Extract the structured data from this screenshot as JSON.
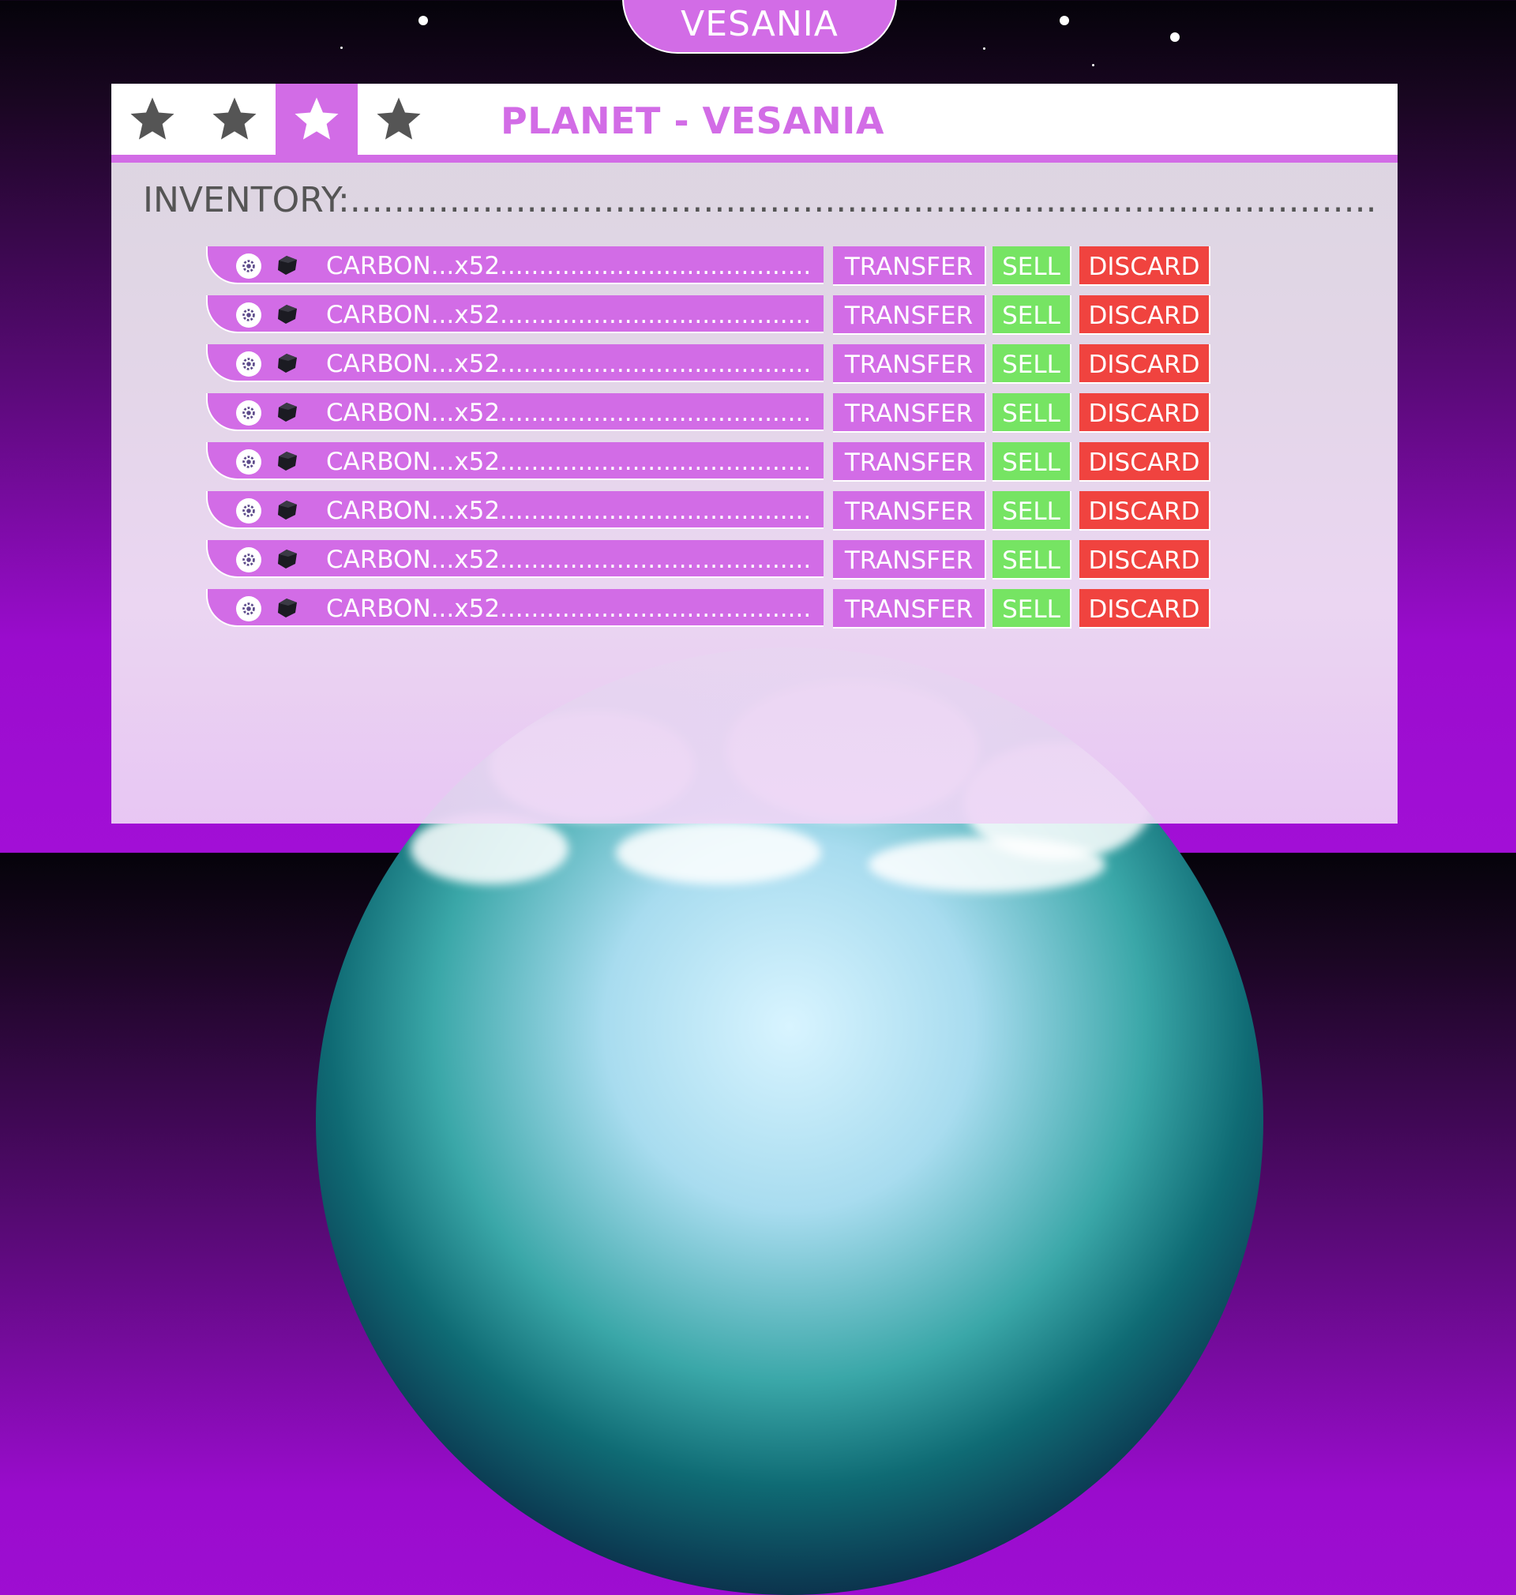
{
  "header": {
    "title": "VESANIA"
  },
  "panel": {
    "title": "PLANET - VESANIA",
    "star_tabs": [
      {
        "icon": "star-icon",
        "active": false
      },
      {
        "icon": "star-icon",
        "active": false
      },
      {
        "icon": "star-icon",
        "active": true
      },
      {
        "icon": "star-icon",
        "active": false
      }
    ],
    "inventory_label": "INVENTORY:..............................................................................................................",
    "items": [
      {
        "label": "CARBON...x52.......................................................",
        "transfer": "TRANSFER",
        "sell": "SELL",
        "discard": "DISCARD"
      },
      {
        "label": "CARBON...x52.......................................................",
        "transfer": "TRANSFER",
        "sell": "SELL",
        "discard": "DISCARD"
      },
      {
        "label": "CARBON...x52.......................................................",
        "transfer": "TRANSFER",
        "sell": "SELL",
        "discard": "DISCARD"
      },
      {
        "label": "CARBON...x52.......................................................",
        "transfer": "TRANSFER",
        "sell": "SELL",
        "discard": "DISCARD"
      },
      {
        "label": "CARBON...x52.......................................................",
        "transfer": "TRANSFER",
        "sell": "SELL",
        "discard": "DISCARD"
      },
      {
        "label": "CARBON...x52.......................................................",
        "transfer": "TRANSFER",
        "sell": "SELL",
        "discard": "DISCARD"
      },
      {
        "label": "CARBON...x52.......................................................",
        "transfer": "TRANSFER",
        "sell": "SELL",
        "discard": "DISCARD"
      },
      {
        "label": "CARBON...x52.......................................................",
        "transfer": "TRANSFER",
        "sell": "SELL",
        "discard": "DISCARD"
      }
    ]
  },
  "colors": {
    "accent": "#d26ce6",
    "sell": "#76e463",
    "discard": "#f0433f",
    "star_inactive": "#555555"
  }
}
